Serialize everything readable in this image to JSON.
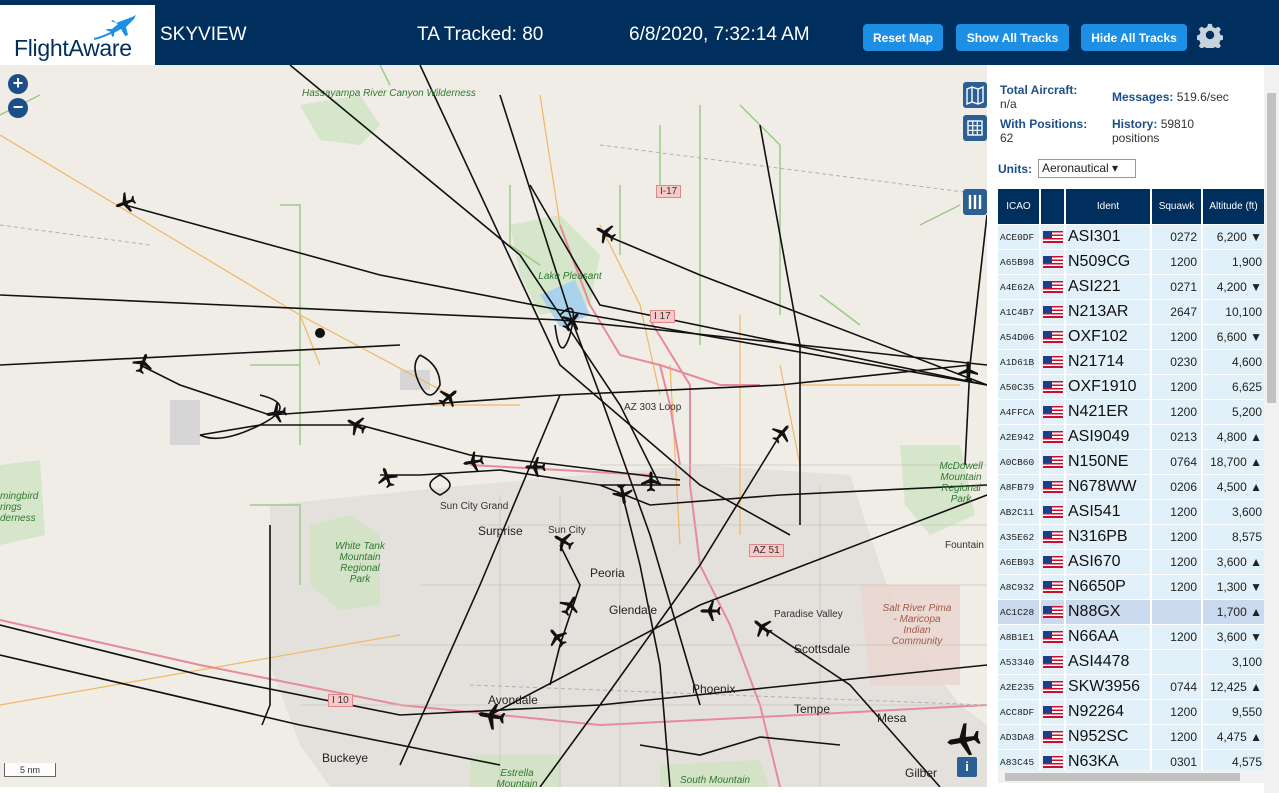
{
  "header": {
    "logo_text": "FlightAware",
    "app_title": "SKYVIEW",
    "tracked": "TA Tracked: 80",
    "clock": "6/8/2020, 7:32:14 AM",
    "buttons": {
      "reset": "Reset Map",
      "show_all": "Show All Tracks",
      "hide_all": "Hide All Tracks"
    },
    "settings_icon": "gear-icon"
  },
  "map": {
    "zoom_in": "+",
    "zoom_out": "−",
    "scale": "5 nm",
    "info": "i",
    "labels": {
      "hassayampa": "Hassayampa River Canyon Wilderness",
      "lake_pleasant": "Lake Pleasant",
      "sun_city_grand": "Sun City Grand",
      "surprise": "Surprise",
      "sun_city": "Sun City",
      "peoria": "Peoria",
      "glendale": "Glendale",
      "paradise_valley": "Paradise Valley",
      "scottsdale": "Scottsdale",
      "phoenix": "Phoenix",
      "tempe": "Tempe",
      "mesa": "Mesa",
      "avondale": "Avondale",
      "buckeye": "Buckeye",
      "gilbert": "Gilber",
      "fountain": "Fountain",
      "white_tank": "White Tank Mountain Regional Park",
      "mcdowell": "McDowell Mountain Regional Park",
      "hummingbird": "mingbird rings derness",
      "salt_river": "Salt River Pima - Maricopa Indian Community",
      "estrella": "Estrella Mountain",
      "south_mountain": "South Mountain",
      "loop": "AZ 303 Loop"
    },
    "shields": {
      "i17_north": "I-17",
      "i17": "I 17",
      "i10": "I 10",
      "az51": "AZ 51"
    }
  },
  "panel": {
    "total_aircraft_label": "Total Aircraft:",
    "total_aircraft_value": "n/a",
    "with_positions_label": "With Positions:",
    "with_positions_value": "62",
    "messages_label": "Messages:",
    "messages_value": "519.6/sec",
    "history_label": "History:",
    "history_value": "59810",
    "history_unit": "positions",
    "units_label": "Units:",
    "units_value": "Aeronautical ▾",
    "columns": [
      "ICAO",
      "",
      "Ident",
      "Squawk",
      "Altitude (ft)"
    ],
    "rows": [
      {
        "icao": "ACE0DF",
        "ident": "ASI301",
        "squawk": "0272",
        "alt": "6,200 ▼"
      },
      {
        "icao": "A65B98",
        "ident": "N509CG",
        "squawk": "1200",
        "alt": "1,900"
      },
      {
        "icao": "A4E62A",
        "ident": "ASI221",
        "squawk": "0271",
        "alt": "4,200 ▼"
      },
      {
        "icao": "A1C4B7",
        "ident": "N213AR",
        "squawk": "2647",
        "alt": "10,100"
      },
      {
        "icao": "A54D06",
        "ident": "OXF102",
        "squawk": "1200",
        "alt": "6,600 ▼"
      },
      {
        "icao": "A1D61B",
        "ident": "N21714",
        "squawk": "0230",
        "alt": "4,600"
      },
      {
        "icao": "A50C35",
        "ident": "OXF1910",
        "squawk": "1200",
        "alt": "6,625"
      },
      {
        "icao": "A4FFCA",
        "ident": "N421ER",
        "squawk": "1200",
        "alt": "5,200"
      },
      {
        "icao": "A2E942",
        "ident": "ASI9049",
        "squawk": "0213",
        "alt": "4,800 ▲"
      },
      {
        "icao": "A0CB60",
        "ident": "N150NE",
        "squawk": "0764",
        "alt": "18,700 ▲"
      },
      {
        "icao": "A8FB79",
        "ident": "N678WW",
        "squawk": "0206",
        "alt": "4,500 ▲"
      },
      {
        "icao": "AB2C11",
        "ident": "ASI541",
        "squawk": "1200",
        "alt": "3,600"
      },
      {
        "icao": "A35E62",
        "ident": "N316PB",
        "squawk": "1200",
        "alt": "8,575"
      },
      {
        "icao": "A6EB93",
        "ident": "ASI670",
        "squawk": "1200",
        "alt": "3,600 ▲"
      },
      {
        "icao": "A8C932",
        "ident": "N6650P",
        "squawk": "1200",
        "alt": "1,300 ▼"
      },
      {
        "icao": "AC1C28",
        "ident": "N88GX",
        "squawk": "",
        "alt": "1,700 ▲",
        "selected": true
      },
      {
        "icao": "A8B1E1",
        "ident": "N66AA",
        "squawk": "1200",
        "alt": "3,600 ▼"
      },
      {
        "icao": "A53340",
        "ident": "ASI4478",
        "squawk": "",
        "alt": "3,100"
      },
      {
        "icao": "A2E235",
        "ident": "SKW3956",
        "squawk": "0744",
        "alt": "12,425 ▲"
      },
      {
        "icao": "ACC8DF",
        "ident": "N92264",
        "squawk": "1200",
        "alt": "9,550"
      },
      {
        "icao": "AD3DA8",
        "ident": "N952SC",
        "squawk": "1200",
        "alt": "4,475 ▲"
      },
      {
        "icao": "A83C45",
        "ident": "N63KA",
        "squawk": "0301",
        "alt": "4,575"
      }
    ]
  }
}
